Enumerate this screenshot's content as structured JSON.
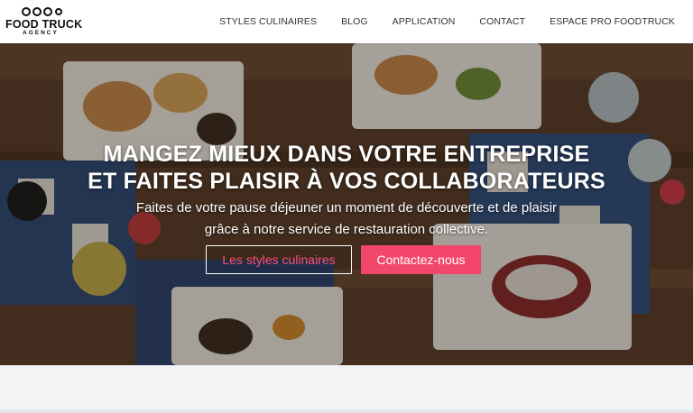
{
  "logo": {
    "title": "FOOD TRUCK",
    "subtitle": "AGENCY"
  },
  "nav": {
    "items": [
      {
        "label": "STYLES CULINAIRES"
      },
      {
        "label": "BLOG"
      },
      {
        "label": "APPLICATION"
      },
      {
        "label": "CONTACT"
      },
      {
        "label": "ESPACE PRO FOODTRUCK"
      }
    ]
  },
  "hero": {
    "title_line1": "MANGEZ MIEUX DANS VOTRE ENTREPRISE",
    "title_line2": "ET FAITES PLAISIR À VOS COLLABORATEURS",
    "subtitle_pre": "Faites de votre ",
    "subtitle_strong": "pause déjeuner",
    "subtitle_post": " un moment de découverte et de plaisir",
    "subtitle_line2": "grâce à notre service de restauration collective.",
    "button_outline": "Les styles culinaires",
    "button_solid": "Contactez-nous"
  },
  "colors": {
    "accent": "#f2476a",
    "nav_text": "#333333"
  }
}
